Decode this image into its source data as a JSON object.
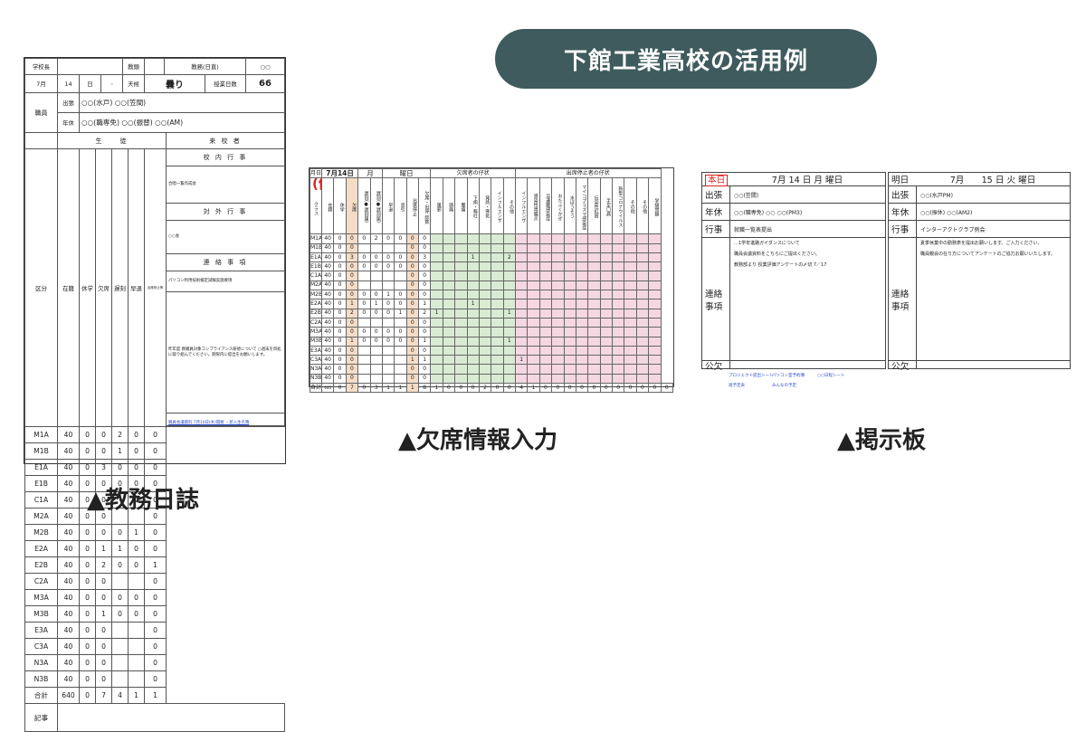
{
  "banner": "下館工業高校の活用例",
  "captions": {
    "diary": "▲教務日誌",
    "absence": "▲欠席情報入力",
    "board": "▲掲示板"
  },
  "diary": {
    "header": {
      "principal": "学校長",
      "vice": "教頭",
      "affairs": "教務(日直)",
      "duty": "○○",
      "month": "7月",
      "day": "14",
      "day_unit": "日",
      "weekday_unit": "◦",
      "weather_label": "天候",
      "weather": "曇り",
      "lessons_label": "授業日数",
      "lessons": "66"
    },
    "staff": {
      "section": "職員",
      "trip_label": "出張",
      "trip": "○○(水戸) ○○(笠間)",
      "leave_label": "年休",
      "leave": "○○(職専免) ○○(振替) ○○(AM)"
    },
    "cols": {
      "students": "生　　徒",
      "visitors": "来 校 者",
      "class": "区分",
      "enrolled": "在籍",
      "suspended": "休学",
      "absent": "欠席",
      "late": "遅刻",
      "early": "早退",
      "stop": "出席停止等"
    },
    "rows": [
      [
        "M1A",
        "40",
        "0",
        "0",
        "2",
        "0",
        "0"
      ],
      [
        "M1B",
        "40",
        "0",
        "0",
        "1",
        "0",
        "0"
      ],
      [
        "E1A",
        "40",
        "0",
        "3",
        "0",
        "0",
        "0"
      ],
      [
        "E1B",
        "40",
        "0",
        "0",
        "0",
        "0",
        "0"
      ],
      [
        "C1A",
        "40",
        "0",
        "0",
        "",
        "",
        "0"
      ],
      [
        "M2A",
        "40",
        "0",
        "0",
        "",
        "",
        "0"
      ],
      [
        "M2B",
        "40",
        "0",
        "0",
        "0",
        "1",
        "0"
      ],
      [
        "E2A",
        "40",
        "0",
        "1",
        "1",
        "0",
        "0"
      ],
      [
        "E2B",
        "40",
        "0",
        "2",
        "0",
        "0",
        "1"
      ],
      [
        "C2A",
        "40",
        "0",
        "0",
        "",
        "",
        "0"
      ],
      [
        "M3A",
        "40",
        "0",
        "0",
        "0",
        "0",
        "0"
      ],
      [
        "M3B",
        "40",
        "0",
        "1",
        "0",
        "0",
        "0"
      ],
      [
        "E3A",
        "40",
        "0",
        "0",
        "",
        "",
        "0"
      ],
      [
        "C3A",
        "40",
        "0",
        "0",
        "",
        "",
        "0"
      ],
      [
        "N3A",
        "40",
        "0",
        "0",
        "",
        "",
        "0"
      ],
      [
        "N3B",
        "40",
        "0",
        "0",
        "",
        "",
        "0"
      ]
    ],
    "total": [
      "合計",
      "640",
      "0",
      "7",
      "4",
      "1",
      "1"
    ],
    "right": {
      "school_events": "校 内 行 事",
      "school_event_note": "合唱一覧作成会",
      "external": "対 外 行 事",
      "external_note": "○○会",
      "contact": "連 絡 事 項",
      "contact_note1": "パソコン利用技術検定試験実施要項",
      "contact_note2": "昨年度 教職員対象コンプライアンス研修について ○週末を目処に取り組んでください。期限内に提出をお願いします。",
      "footer_link": "職員会議資料 7月10日(木)開催 ・新入生名簿"
    },
    "notes_label": "記事"
  },
  "absence": {
    "month": "月日",
    "date": "7月14日",
    "mon": "月",
    "weekday": "曜日",
    "rei": "(例)",
    "group_absent": "欠席者の仔状",
    "group_stop": "出席停止者の仔状",
    "left_headers": [
      "クラス",
      "在籍",
      "休学",
      "欠席",
      "遅刻(●遅刻届)",
      "遅刻(●遅刻届)",
      "早退",
      "忌引",
      "出席停止",
      "欠席・出停 総数"
    ],
    "absent_headers": [
      "風邪",
      "頭痛",
      "腹痛",
      "下痢・嘔吐",
      "発熱・寒気",
      "インフルエンザ",
      "その他"
    ],
    "stop_headers": [
      "インフルエンザ",
      "感染性胃腸炎",
      "溶連菌感染症",
      "おたふくかぜ",
      "水ぼうそう",
      "マイコプラズマ感染症",
      "伝染性紅斑",
      "手足口病",
      "新型コロナウイルス",
      "その他",
      "その他",
      "学級閉鎖"
    ],
    "rows": [
      [
        "M1A",
        "40",
        "0",
        "0",
        "0",
        "2",
        "0",
        "0",
        "0",
        "0"
      ],
      [
        "M1B",
        "40",
        "0",
        "0",
        "",
        "",
        "",
        "",
        "0",
        "0"
      ],
      [
        "E1A",
        "40",
        "0",
        "3",
        "0",
        "0",
        "0",
        "0",
        "0",
        "3"
      ],
      [
        "E1B",
        "40",
        "0",
        "0",
        "0",
        "0",
        "0",
        "0",
        "0",
        "0"
      ],
      [
        "C1A",
        "40",
        "0",
        "0",
        "",
        "",
        "",
        "",
        "0",
        "0"
      ],
      [
        "M2A",
        "40",
        "0",
        "0",
        "",
        "",
        "",
        "",
        "0",
        "0"
      ],
      [
        "M2B",
        "40",
        "0",
        "0",
        "0",
        "0",
        "1",
        "0",
        "0",
        "0"
      ],
      [
        "E2A",
        "40",
        "0",
        "1",
        "0",
        "1",
        "0",
        "0",
        "0",
        "1"
      ],
      [
        "E2B",
        "40",
        "0",
        "2",
        "0",
        "0",
        "0",
        "1",
        "0",
        "2"
      ],
      [
        "C2A",
        "40",
        "0",
        "0",
        "",
        "",
        "",
        "",
        "0",
        "0"
      ],
      [
        "M3A",
        "40",
        "0",
        "0",
        "0",
        "0",
        "0",
        "0",
        "0",
        "0"
      ],
      [
        "M3B",
        "40",
        "0",
        "1",
        "0",
        "0",
        "0",
        "0",
        "0",
        "1"
      ],
      [
        "E3A",
        "40",
        "0",
        "0",
        "",
        "",
        "",
        "",
        "0",
        "0"
      ],
      [
        "C3A",
        "40",
        "0",
        "0",
        "",
        "",
        "",
        "",
        "1",
        "1"
      ],
      [
        "N3A",
        "40",
        "0",
        "0",
        "",
        "",
        "",
        "",
        "0",
        "0"
      ],
      [
        "N3B",
        "40",
        "0",
        "0",
        "",
        "",
        "",
        "",
        "0",
        "0"
      ]
    ],
    "marks": {
      "E1A": {
        "a3": "1",
        "a6": "2"
      },
      "E2A": {
        "a3": "1"
      },
      "E2B": {
        "a0": "1",
        "a6": "1"
      },
      "M3B": {
        "a6": "1"
      },
      "C3A": {
        "s0": "1"
      }
    },
    "total_label": "合計",
    "total_enrolled": "640",
    "total_rest": [
      "0",
      "7",
      "0",
      "3",
      "1",
      "1",
      "1",
      "8",
      "1",
      "0",
      "0",
      "0",
      "2",
      "0",
      "0",
      "4",
      "1",
      "0",
      "0",
      "0",
      "0",
      "0",
      "0",
      "0",
      "0",
      "0",
      "0",
      "0"
    ]
  },
  "board": {
    "today": {
      "tag": "本日",
      "date": "7月 14 日 月 曜日",
      "trip": "○○(笠間)",
      "leave": "○○(職専免) ○○ ○○(PM3)",
      "event": "就職一覧表提出",
      "notes": [
        "…1学年進路ガイダンスについて",
        "職員会議資料をこちらにご提出ください。",
        "教務部より 授業評価アンケートの〆切 7／17"
      ]
    },
    "tomorrow": {
      "tag": "明日",
      "date": "7月　　15 日 火 曜日",
      "trip": "○○(水戸PM)",
      "leave": "○○(振休) ○○(AM2)",
      "event": "インターアクトクラブ例会",
      "notes": [
        "夏季休業中の勤務表を提出お願いします。ご入力ください。",
        "職員親会の在り方についてアンケートのご協力お願いいたします。"
      ]
    },
    "labels": {
      "trip": "出張",
      "leave": "年休",
      "event": "行事",
      "contact": "連絡事項",
      "notice": "公欠"
    },
    "links": [
      "プロジェクト提出シート",
      "パソコン室予約簿",
      "○○日程シート",
      "週予定表",
      "みんなの予定"
    ]
  }
}
